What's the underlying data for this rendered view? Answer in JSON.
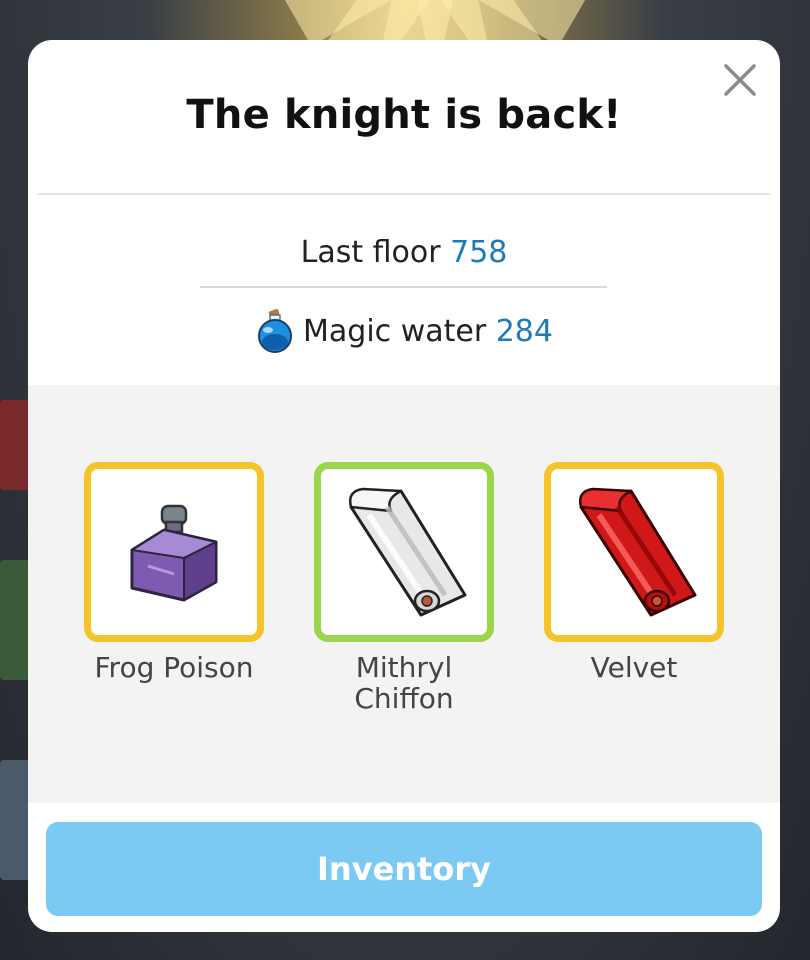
{
  "popup": {
    "title": "The knight is back!",
    "close_icon": "close-icon"
  },
  "stats": {
    "last_floor_label": "Last floor",
    "last_floor_value": "758",
    "magic_water_label": "Magic water",
    "magic_water_value": "284",
    "magic_water_icon": "potion-icon"
  },
  "items": [
    {
      "label": "Frog Poison",
      "icon": "purple-potion-bottle-icon",
      "frame_color": "#f4c52b"
    },
    {
      "label": "Mithryl Chiffon",
      "icon": "white-fabric-roll-icon",
      "frame_color": "#9ad64b"
    },
    {
      "label": "Velvet",
      "icon": "red-fabric-roll-icon",
      "frame_color": "#f4c52b"
    }
  ],
  "inventory_button": {
    "label": "Inventory"
  },
  "colors": {
    "accent_number": "#1f79b8",
    "button_bg": "#7ccaf4",
    "rare_frame": "#f4c52b",
    "uncommon_frame": "#9ad64b"
  }
}
